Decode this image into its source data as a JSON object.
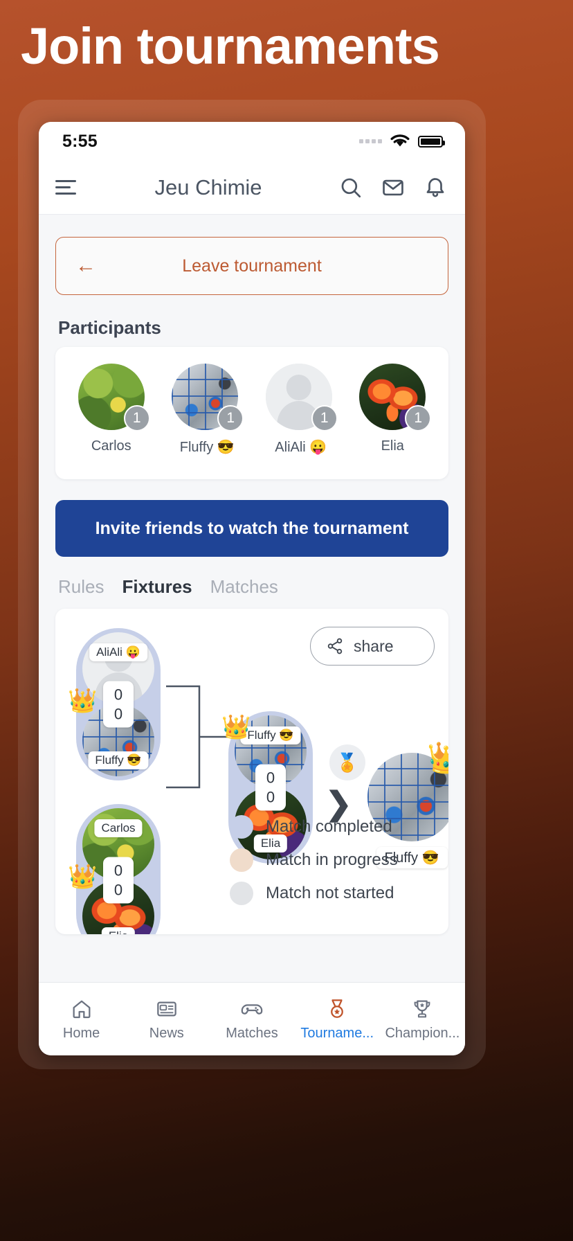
{
  "hero": {
    "title": "Join tournaments"
  },
  "status_bar": {
    "time": "5:55",
    "wifi_icon": "wifi-icon",
    "battery_icon": "battery-icon",
    "signal_icon": "signal-dots-icon"
  },
  "app_bar": {
    "title": "Jeu Chimie",
    "menu_icon": "hamburger-menu-icon",
    "search_icon": "search-icon",
    "mail_icon": "mail-icon",
    "bell_icon": "bell-icon"
  },
  "leave_button": {
    "label": "Leave tournament",
    "icon": "arrow-left-icon",
    "color": "#bc5a32"
  },
  "participants": {
    "heading": "Participants",
    "items": [
      {
        "name": "Carlos",
        "badge": "1",
        "avatar": "leaves-photo"
      },
      {
        "name": "Fluffy 😎",
        "badge": "1",
        "avatar": "collage-photo"
      },
      {
        "name": "AliAli 😛",
        "badge": "1",
        "avatar": "default-person-avatar"
      },
      {
        "name": "Elia",
        "badge": "1",
        "avatar": "flowers-photo"
      }
    ]
  },
  "invite_button": {
    "label": "Invite friends to watch the tournament",
    "color": "#1f4496"
  },
  "tabs": [
    {
      "label": "Rules",
      "active": false
    },
    {
      "label": "Fixtures",
      "active": true
    },
    {
      "label": "Matches",
      "active": false
    }
  ],
  "bracket": {
    "share_button": {
      "label": "share",
      "icon": "share-icon"
    },
    "matches": [
      {
        "id": "semifinal-1",
        "status": "completed",
        "top": {
          "name": "AliAli 😛",
          "avatar": "default-person-avatar",
          "winner": false
        },
        "bottom": {
          "name": "Fluffy 😎",
          "avatar": "collage-photo",
          "winner": true
        },
        "score_top": "0",
        "score_bottom": "0"
      },
      {
        "id": "semifinal-2",
        "status": "completed",
        "top": {
          "name": "Carlos",
          "avatar": "leaves-photo",
          "winner": false
        },
        "bottom": {
          "name": "Elia",
          "avatar": "flowers-photo",
          "winner": true
        },
        "score_top": "0",
        "score_bottom": "0"
      },
      {
        "id": "final",
        "status": "completed",
        "top": {
          "name": "Fluffy 😎",
          "avatar": "collage-photo",
          "winner": true
        },
        "bottom": {
          "name": "Elia",
          "avatar": "flowers-photo",
          "winner": false
        },
        "score_top": "0",
        "score_bottom": "0"
      }
    ],
    "champion": {
      "name": "Fluffy 😎",
      "avatar": "collage-photo",
      "crown_icon": "crown-icon",
      "medal_icon": "medal-icon"
    },
    "next_icon": "chevron-right-icon",
    "legend": [
      {
        "label": "Match completed",
        "color": "#c6cfe8"
      },
      {
        "label": "Match in progress",
        "color": "#f0dccb"
      },
      {
        "label": "Match not started",
        "color": "#e2e4e7"
      }
    ]
  },
  "bottom_nav": {
    "items": [
      {
        "label": "Home",
        "icon": "home-icon",
        "active": false
      },
      {
        "label": "News",
        "icon": "news-icon",
        "active": false
      },
      {
        "label": "Matches",
        "icon": "gamepad-icon",
        "active": false
      },
      {
        "label": "Tourname...",
        "icon": "medal-icon",
        "active": true
      },
      {
        "label": "Champion...",
        "icon": "trophy-icon",
        "active": false
      }
    ],
    "active_color": "#1f7ae0"
  }
}
